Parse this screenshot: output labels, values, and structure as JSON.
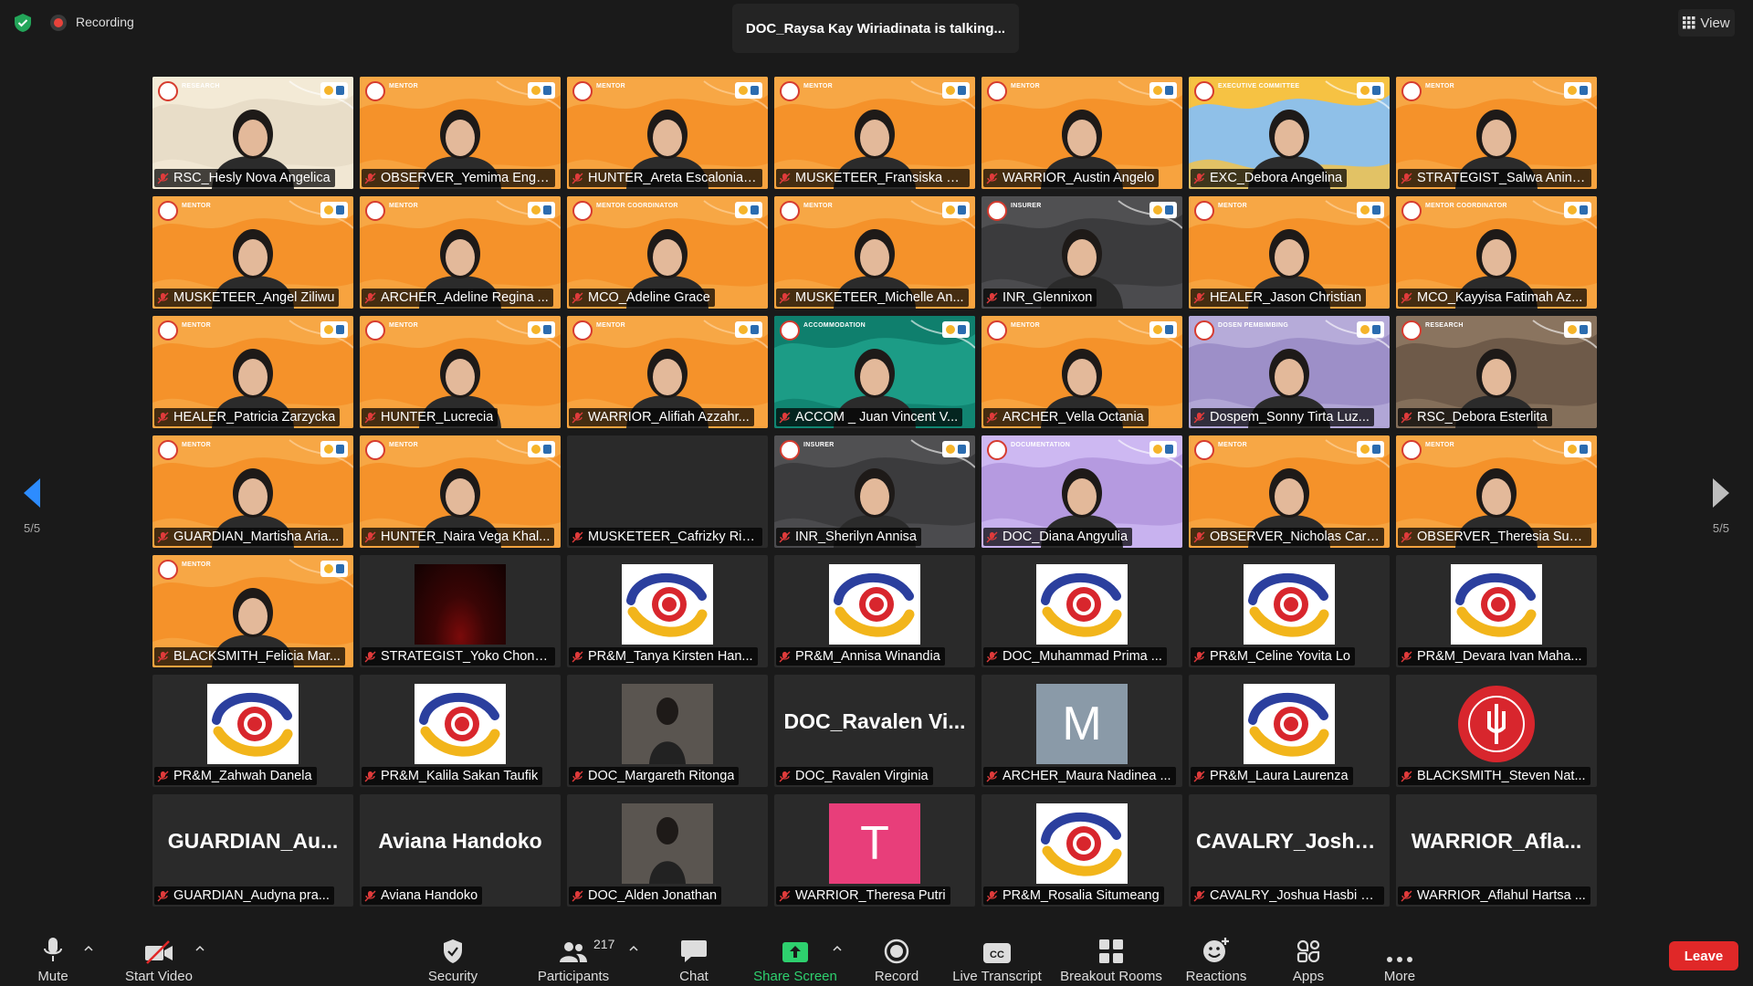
{
  "top": {
    "recording_label": "Recording",
    "talking": "DOC_Raysa Kay Wiriadinata is talking...",
    "view_label": "View"
  },
  "nav": {
    "page_left": "5/5",
    "page_right": "5/5"
  },
  "participants": [
    {
      "name": "RSC_Hesly Nova Angelica",
      "kind": "video",
      "bg": "beige",
      "tag": "RESEARCH"
    },
    {
      "name": "OBSERVER_Yemima Engk...",
      "kind": "video",
      "bg": "orange",
      "tag": "MENTOR"
    },
    {
      "name": "HUNTER_Areta Escalonia ...",
      "kind": "video",
      "bg": "orange",
      "tag": "MENTOR"
    },
    {
      "name": "MUSKETEER_Fransiska Sz...",
      "kind": "video",
      "bg": "orange",
      "tag": "MENTOR"
    },
    {
      "name": "WARRIOR_Austin Angelo",
      "kind": "video",
      "bg": "orange",
      "tag": "MENTOR"
    },
    {
      "name": "EXC_Debora Angelina",
      "kind": "video",
      "bg": "blue",
      "tag": "EXECUTIVE COMMITTEE"
    },
    {
      "name": "STRATEGIST_Salwa Anind...",
      "kind": "video",
      "bg": "orange",
      "tag": "MENTOR"
    },
    {
      "name": "MUSKETEER_Angel Ziliwu",
      "kind": "video",
      "bg": "orange",
      "tag": "MENTOR"
    },
    {
      "name": "ARCHER_Adeline Regina ...",
      "kind": "video",
      "bg": "orange",
      "tag": "MENTOR"
    },
    {
      "name": "MCO_Adeline Grace",
      "kind": "video",
      "bg": "orange",
      "tag": "MENTOR COORDINATOR"
    },
    {
      "name": "MUSKETEER_Michelle An...",
      "kind": "video",
      "bg": "orange",
      "tag": "MENTOR"
    },
    {
      "name": "INR_Glennixon",
      "kind": "video",
      "bg": "gray",
      "tag": "INSURER"
    },
    {
      "name": "HEALER_Jason Christian",
      "kind": "video",
      "bg": "orange",
      "tag": "MENTOR"
    },
    {
      "name": "MCO_Kayyisa Fatimah Az...",
      "kind": "video",
      "bg": "orange",
      "tag": "MENTOR COORDINATOR"
    },
    {
      "name": "HEALER_Patricia Zarzycka",
      "kind": "video",
      "bg": "orange",
      "tag": "MENTOR"
    },
    {
      "name": "HUNTER_Lucrecia",
      "kind": "video",
      "bg": "orange",
      "tag": "MENTOR"
    },
    {
      "name": "WARRIOR_Alifiah Azzahr...",
      "kind": "video",
      "bg": "orange",
      "tag": "MENTOR"
    },
    {
      "name": "ACCOM _ Juan Vincent V...",
      "kind": "video",
      "bg": "teal",
      "tag": "ACCOMMODATION"
    },
    {
      "name": "ARCHER_Vella Octania",
      "kind": "video",
      "bg": "orange",
      "tag": "MENTOR"
    },
    {
      "name": "Dospem_Sonny Tirta Luz...",
      "kind": "video",
      "bg": "lavender",
      "tag": "DOSEN PEMBIMBING"
    },
    {
      "name": "RSC_Debora Esterlita",
      "kind": "video",
      "bg": "brown",
      "tag": "RESEARCH"
    },
    {
      "name": "GUARDIAN_Martisha Aria...",
      "kind": "video",
      "bg": "orange",
      "tag": "MENTOR"
    },
    {
      "name": "HUNTER_Naira Vega Khal...",
      "kind": "video",
      "bg": "orange",
      "tag": "MENTOR"
    },
    {
      "name": "MUSKETEER_Cafrizky Riz...",
      "kind": "empty"
    },
    {
      "name": "INR_Sherilyn Annisa",
      "kind": "video",
      "bg": "gray",
      "tag": "INSURER"
    },
    {
      "name": "DOC_Diana Angyulia",
      "kind": "video",
      "bg": "purple",
      "tag": "DOCUMENTATION"
    },
    {
      "name": "OBSERVER_Nicholas Carl...",
      "kind": "video",
      "bg": "orange",
      "tag": "MENTOR"
    },
    {
      "name": "OBSERVER_Theresia Susa...",
      "kind": "video",
      "bg": "orange",
      "tag": "MENTOR"
    },
    {
      "name": "BLACKSMITH_Felicia Mar...",
      "kind": "video",
      "bg": "orange",
      "tag": "MENTOR"
    },
    {
      "name": "STRATEGIST_Yoko Chond...",
      "kind": "dark"
    },
    {
      "name": "PR&M_Tanya Kirsten Han...",
      "kind": "logo"
    },
    {
      "name": "PR&M_Annisa Winandia",
      "kind": "logo"
    },
    {
      "name": "DOC_Muhammad Prima ...",
      "kind": "logo"
    },
    {
      "name": "PR&M_Celine Yovita Lo",
      "kind": "logo"
    },
    {
      "name": "PR&M_Devara Ivan Maha...",
      "kind": "logo"
    },
    {
      "name": "PR&M_Zahwah Danela",
      "kind": "logo"
    },
    {
      "name": "PR&M_Kalila Sakan Taufik",
      "kind": "logo"
    },
    {
      "name": "DOC_Margareth Ritonga",
      "kind": "photo"
    },
    {
      "name": "DOC_Ravalen Virginia",
      "kind": "bigname",
      "big": "DOC_Ravalen  Vi..."
    },
    {
      "name": "ARCHER_Maura Nadinea ...",
      "kind": "letter",
      "letter": "M",
      "letter_bg": "#8a9aa8"
    },
    {
      "name": "PR&M_Laura Laurenza",
      "kind": "logo"
    },
    {
      "name": "BLACKSMITH_Steven Nat...",
      "kind": "redlogo"
    },
    {
      "name": "GUARDIAN_Audyna pra...",
      "kind": "bigname",
      "big": "GUARDIAN_Au..."
    },
    {
      "name": "Aviana Handoko",
      "kind": "bigname",
      "big": "Aviana Handoko"
    },
    {
      "name": "DOC_Alden Jonathan",
      "kind": "photo"
    },
    {
      "name": "WARRIOR_Theresa Putri",
      "kind": "letter",
      "letter": "T",
      "letter_bg": "#e83e7a"
    },
    {
      "name": "PR&M_Rosalia Situmeang",
      "kind": "logo"
    },
    {
      "name": "CAVALRY_Joshua Hasbi S...",
      "kind": "bigname",
      "big": "CAVALRY_Joshu..."
    },
    {
      "name": "WARRIOR_Aflahul Hartsa ...",
      "kind": "bigname",
      "big": "WARRIOR_Afla..."
    }
  ],
  "toolbar": {
    "mute": "Mute",
    "start_video": "Start Video",
    "security": "Security",
    "participants": "Participants",
    "participants_count": "217",
    "chat": "Chat",
    "share_screen": "Share Screen",
    "record": "Record",
    "live_transcript": "Live Transcript",
    "breakout_rooms": "Breakout Rooms",
    "reactions": "Reactions",
    "apps": "Apps",
    "more": "More",
    "leave": "Leave",
    "cc_text": "CC"
  },
  "colors": {
    "background": "#1a1a1a",
    "orange": "#f5922a",
    "leave": "#e02828",
    "share_green": "#2ed06e"
  }
}
